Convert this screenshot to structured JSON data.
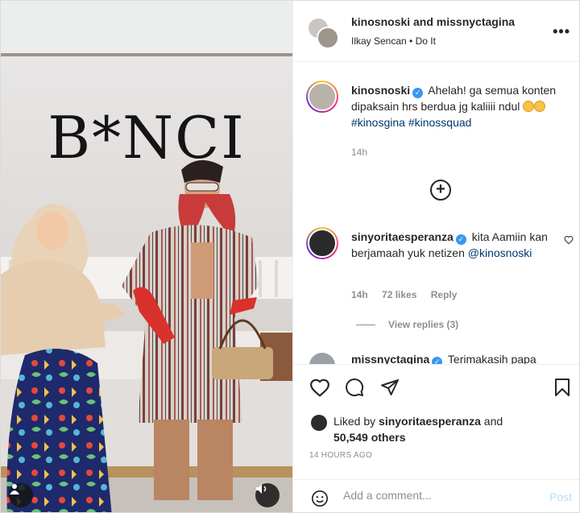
{
  "post": {
    "overlay_title": "B*NCI"
  },
  "header": {
    "title": "kinosnoski and missnyctagina",
    "subtitle": "Ilkay Sencan • Do It",
    "more_icon": "more-horizontal-icon"
  },
  "caption": {
    "username": "kinosnoski",
    "text": "Ahelah! ga semua konten dipaksain hrs berdua jg kaliiii ndul",
    "hashtags": [
      "#kinosgina",
      "#kinossquad"
    ],
    "time": "14h"
  },
  "comments": [
    {
      "username": "sinyoritaesperanza",
      "text": "kita Aamiin kan berjamaah yuk netizen",
      "mention": "@kinosnoski",
      "time": "14h",
      "likes": "72 likes",
      "reply_label": "Reply",
      "view_replies": "View replies (3)"
    },
    {
      "username": "missnyctagina",
      "text": "Terimakasih papa"
    }
  ],
  "actions": {
    "liked_prefix": "Liked by ",
    "liked_user": "sinyoritaesperanza",
    "liked_suffix": " and",
    "others": "50,549 others",
    "posted_ago": "14 HOURS AGO"
  },
  "add_comment": {
    "placeholder": "Add a comment...",
    "post_label": "Post"
  },
  "colors": {
    "link": "#00376b",
    "verified": "#3897f0",
    "muted": "#8e8e8e",
    "post_disabled": "#b2dffc"
  }
}
